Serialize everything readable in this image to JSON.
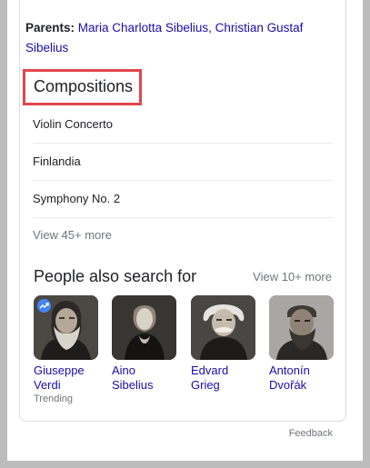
{
  "parents": {
    "label": "Parents:",
    "names": [
      "Maria Charlotta Sibelius",
      "Christian Gustaf Sibelius"
    ],
    "separator": ", "
  },
  "compositions": {
    "title": "Compositions",
    "items": [
      "Violin Concerto",
      "Finlandia",
      "Symphony No. 2"
    ],
    "view_more": "View 45+ more"
  },
  "people_also_search": {
    "title": "People also search for",
    "view_more": "View 10+ more",
    "people": [
      {
        "name_line1": "Giuseppe",
        "name_line2": "Verdi",
        "subtitle": "Trending",
        "badge": "trending-icon"
      },
      {
        "name_line1": "Aino",
        "name_line2": "Sibelius",
        "subtitle": ""
      },
      {
        "name_line1": "Edvard",
        "name_line2": "Grieg",
        "subtitle": ""
      },
      {
        "name_line1": "Antonín",
        "name_line2": "Dvořák",
        "subtitle": ""
      }
    ]
  },
  "feedback": "Feedback",
  "colors": {
    "link": "#1a0dab",
    "highlight_border": "#e0474c",
    "muted": "#70757a",
    "badge": "#4285f4"
  }
}
